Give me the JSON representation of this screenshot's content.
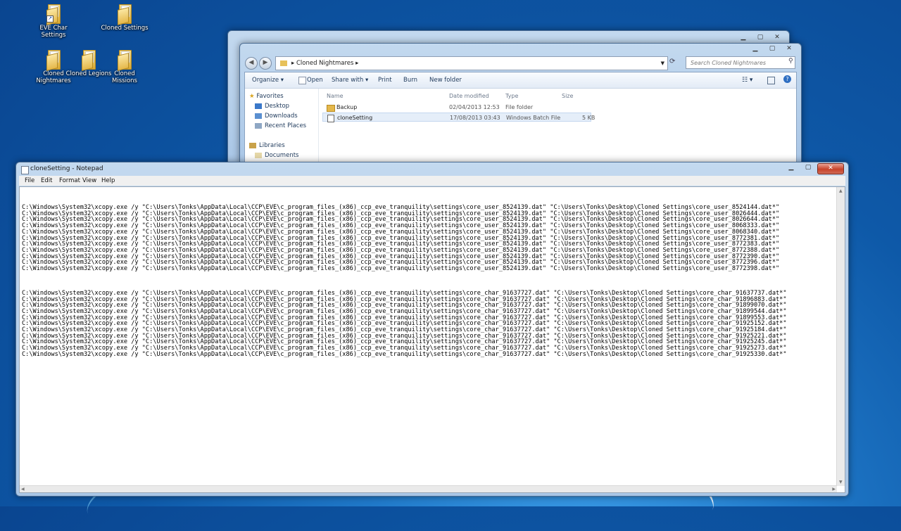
{
  "desktop_icons": [
    {
      "label": "EVE Char Settings",
      "shortcut": true
    },
    {
      "label": "Cloned Settings",
      "shortcut": false
    },
    {
      "label": "Cloned Nightmares",
      "shortcut": false
    },
    {
      "label": "Cloned Legions",
      "shortcut": false
    },
    {
      "label": "Cloned Missions",
      "shortcut": false
    }
  ],
  "explorer": {
    "address": "Cloned Nightmares",
    "search_placeholder": "Search Cloned Nightmares",
    "toolbar": {
      "organize": "Organize ▾",
      "open": "Open",
      "share_with": "Share with ▾",
      "print": "Print",
      "burn": "Burn",
      "new_folder": "New folder"
    },
    "nav": {
      "favorites": "Favorites",
      "desktop": "Desktop",
      "downloads": "Downloads",
      "recent_places": "Recent Places",
      "libraries": "Libraries",
      "documents": "Documents"
    },
    "columns": {
      "name": "Name",
      "date_modified": "Date modified",
      "type": "Type",
      "size": "Size"
    },
    "files": [
      {
        "name": "Backup",
        "date": "02/04/2013 12:53",
        "type": "File folder",
        "size": ""
      },
      {
        "name": "cloneSetting",
        "date": "17/08/2013 03:43",
        "type": "Windows Batch File",
        "size": "5 KB"
      }
    ]
  },
  "notepad": {
    "title": "cloneSetting - Notepad",
    "menu": {
      "file": "File",
      "edit": "Edit",
      "format": "Format",
      "view": "View",
      "help": "Help"
    },
    "content": "C:\\Windows\\System32\\xcopy.exe /y \"C:\\Users\\Tonks\\AppData\\Local\\CCP\\EVE\\c_program_files_(x86)_ccp_eve_tranquility\\settings\\core_user_8524139.dat\" \"C:\\Users\\Tonks\\Desktop\\Cloned Settings\\core_user_8524144.dat*\"\nC:\\Windows\\System32\\xcopy.exe /y \"C:\\Users\\Tonks\\AppData\\Local\\CCP\\EVE\\c_program_files_(x86)_ccp_eve_tranquility\\settings\\core_user_8524139.dat\" \"C:\\Users\\Tonks\\Desktop\\Cloned Settings\\core_user_8026444.dat*\"\nC:\\Windows\\System32\\xcopy.exe /y \"C:\\Users\\Tonks\\AppData\\Local\\CCP\\EVE\\c_program_files_(x86)_ccp_eve_tranquility\\settings\\core_user_8524139.dat\" \"C:\\Users\\Tonks\\Desktop\\Cloned Settings\\core_user_8026644.dat*\"\nC:\\Windows\\System32\\xcopy.exe /y \"C:\\Users\\Tonks\\AppData\\Local\\CCP\\EVE\\c_program_files_(x86)_ccp_eve_tranquility\\settings\\core_user_8524139.dat\" \"C:\\Users\\Tonks\\Desktop\\Cloned Settings\\core_user_8068333.dat*\"\nC:\\Windows\\System32\\xcopy.exe /y \"C:\\Users\\Tonks\\AppData\\Local\\CCP\\EVE\\c_program_files_(x86)_ccp_eve_tranquility\\settings\\core_user_8524139.dat\" \"C:\\Users\\Tonks\\Desktop\\Cloned Settings\\core_user_8068340.dat*\"\nC:\\Windows\\System32\\xcopy.exe /y \"C:\\Users\\Tonks\\AppData\\Local\\CCP\\EVE\\c_program_files_(x86)_ccp_eve_tranquility\\settings\\core_user_8524139.dat\" \"C:\\Users\\Tonks\\Desktop\\Cloned Settings\\core_user_8772381.dat*\"\nC:\\Windows\\System32\\xcopy.exe /y \"C:\\Users\\Tonks\\AppData\\Local\\CCP\\EVE\\c_program_files_(x86)_ccp_eve_tranquility\\settings\\core_user_8524139.dat\" \"C:\\Users\\Tonks\\Desktop\\Cloned Settings\\core_user_8772383.dat*\"\nC:\\Windows\\System32\\xcopy.exe /y \"C:\\Users\\Tonks\\AppData\\Local\\CCP\\EVE\\c_program_files_(x86)_ccp_eve_tranquility\\settings\\core_user_8524139.dat\" \"C:\\Users\\Tonks\\Desktop\\Cloned Settings\\core_user_8772388.dat*\"\nC:\\Windows\\System32\\xcopy.exe /y \"C:\\Users\\Tonks\\AppData\\Local\\CCP\\EVE\\c_program_files_(x86)_ccp_eve_tranquility\\settings\\core_user_8524139.dat\" \"C:\\Users\\Tonks\\Desktop\\Cloned Settings\\core_user_8772390.dat*\"\nC:\\Windows\\System32\\xcopy.exe /y \"C:\\Users\\Tonks\\AppData\\Local\\CCP\\EVE\\c_program_files_(x86)_ccp_eve_tranquility\\settings\\core_user_8524139.dat\" \"C:\\Users\\Tonks\\Desktop\\Cloned Settings\\core_user_8772396.dat*\"\nC:\\Windows\\System32\\xcopy.exe /y \"C:\\Users\\Tonks\\AppData\\Local\\CCP\\EVE\\c_program_files_(x86)_ccp_eve_tranquility\\settings\\core_user_8524139.dat\" \"C:\\Users\\Tonks\\Desktop\\Cloned Settings\\core_user_8772398.dat*\"\n\n\n\nC:\\Windows\\System32\\xcopy.exe /y \"C:\\Users\\Tonks\\AppData\\Local\\CCP\\EVE\\c_program_files_(x86)_ccp_eve_tranquility\\settings\\core_char_91637727.dat\" \"C:\\Users\\Tonks\\Desktop\\Cloned Settings\\core_char_91637737.dat*\"\nC:\\Windows\\System32\\xcopy.exe /y \"C:\\Users\\Tonks\\AppData\\Local\\CCP\\EVE\\c_program_files_(x86)_ccp_eve_tranquility\\settings\\core_char_91637727.dat\" \"C:\\Users\\Tonks\\Desktop\\Cloned Settings\\core_char_91896883.dat*\"\nC:\\Windows\\System32\\xcopy.exe /y \"C:\\Users\\Tonks\\AppData\\Local\\CCP\\EVE\\c_program_files_(x86)_ccp_eve_tranquility\\settings\\core_char_91637727.dat\" \"C:\\Users\\Tonks\\Desktop\\Cloned Settings\\core_char_91899070.dat*\"\nC:\\Windows\\System32\\xcopy.exe /y \"C:\\Users\\Tonks\\AppData\\Local\\CCP\\EVE\\c_program_files_(x86)_ccp_eve_tranquility\\settings\\core_char_91637727.dat\" \"C:\\Users\\Tonks\\Desktop\\Cloned Settings\\core_char_91899544.dat*\"\nC:\\Windows\\System32\\xcopy.exe /y \"C:\\Users\\Tonks\\AppData\\Local\\CCP\\EVE\\c_program_files_(x86)_ccp_eve_tranquility\\settings\\core_char_91637727.dat\" \"C:\\Users\\Tonks\\Desktop\\Cloned Settings\\core_char_91899553.dat*\"\nC:\\Windows\\System32\\xcopy.exe /y \"C:\\Users\\Tonks\\AppData\\Local\\CCP\\EVE\\c_program_files_(x86)_ccp_eve_tranquility\\settings\\core_char_91637727.dat\" \"C:\\Users\\Tonks\\Desktop\\Cloned Settings\\core_char_91925152.dat*\"\nC:\\Windows\\System32\\xcopy.exe /y \"C:\\Users\\Tonks\\AppData\\Local\\CCP\\EVE\\c_program_files_(x86)_ccp_eve_tranquility\\settings\\core_char_91637727.dat\" \"C:\\Users\\Tonks\\Desktop\\Cloned Settings\\core_char_91925184.dat*\"\nC:\\Windows\\System32\\xcopy.exe /y \"C:\\Users\\Tonks\\AppData\\Local\\CCP\\EVE\\c_program_files_(x86)_ccp_eve_tranquility\\settings\\core_char_91637727.dat\" \"C:\\Users\\Tonks\\Desktop\\Cloned Settings\\core_char_91925221.dat*\"\nC:\\Windows\\System32\\xcopy.exe /y \"C:\\Users\\Tonks\\AppData\\Local\\CCP\\EVE\\c_program_files_(x86)_ccp_eve_tranquility\\settings\\core_char_91637727.dat\" \"C:\\Users\\Tonks\\Desktop\\Cloned Settings\\core_char_91925245.dat*\"\nC:\\Windows\\System32\\xcopy.exe /y \"C:\\Users\\Tonks\\AppData\\Local\\CCP\\EVE\\c_program_files_(x86)_ccp_eve_tranquility\\settings\\core_char_91637727.dat\" \"C:\\Users\\Tonks\\Desktop\\Cloned Settings\\core_char_91925273.dat*\"\nC:\\Windows\\System32\\xcopy.exe /y \"C:\\Users\\Tonks\\AppData\\Local\\CCP\\EVE\\c_program_files_(x86)_ccp_eve_tranquility\\settings\\core_char_91637727.dat\" \"C:\\Users\\Tonks\\Desktop\\Cloned Settings\\core_char_91925330.dat*\""
  }
}
